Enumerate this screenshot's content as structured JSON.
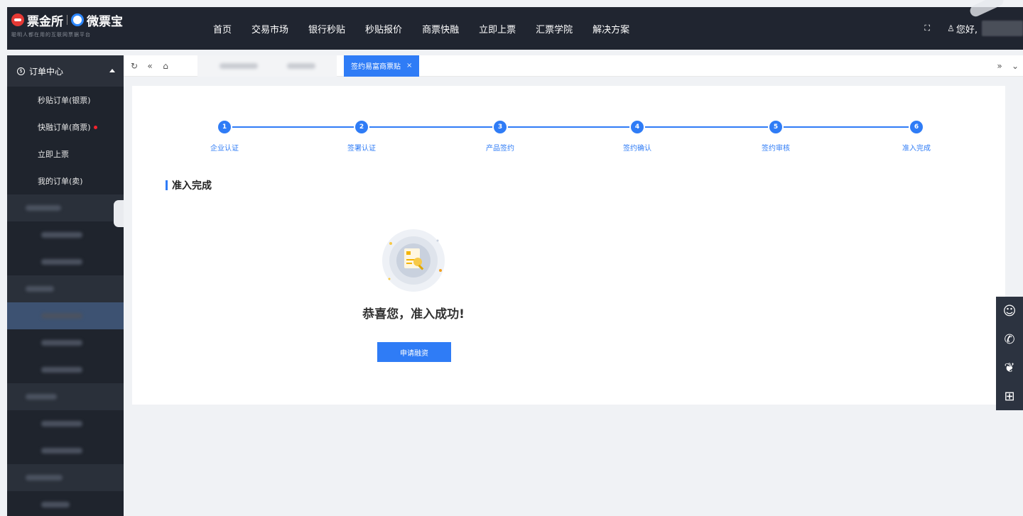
{
  "brand": {
    "name": "票金所",
    "partner": "微票宝",
    "tagline": "聪明人都在用的互联网票据平台"
  },
  "nav": {
    "items": [
      "首页",
      "交易市场",
      "银行秒贴",
      "秒贴报价",
      "商票快融",
      "立即上票",
      "汇票学院",
      "解决方案"
    ],
    "fullscreen_icon": "expand-icon",
    "greeting": "您好,"
  },
  "sidebar": {
    "section": "订单中心",
    "items": [
      "秒贴订单(银票)",
      "快融订单(商票)",
      "立即上票",
      "我的订单(卖)"
    ]
  },
  "tabs": {
    "active_label": "签约易富商票贴",
    "close": "×"
  },
  "steps": [
    "企业认证",
    "签署认证",
    "产品签约",
    "签约确认",
    "签约审核",
    "准入完成"
  ],
  "main": {
    "section_title": "准入完成",
    "success_message": "恭喜您，准入成功!",
    "apply_button": "申请融资"
  },
  "floating": {
    "icons": [
      "customer-service-icon",
      "phone-icon",
      "wechat-icon",
      "calculator-icon"
    ]
  },
  "colors": {
    "primary": "#2f7cf6",
    "topbar": "#202530",
    "sidebar": "#1f242d"
  }
}
